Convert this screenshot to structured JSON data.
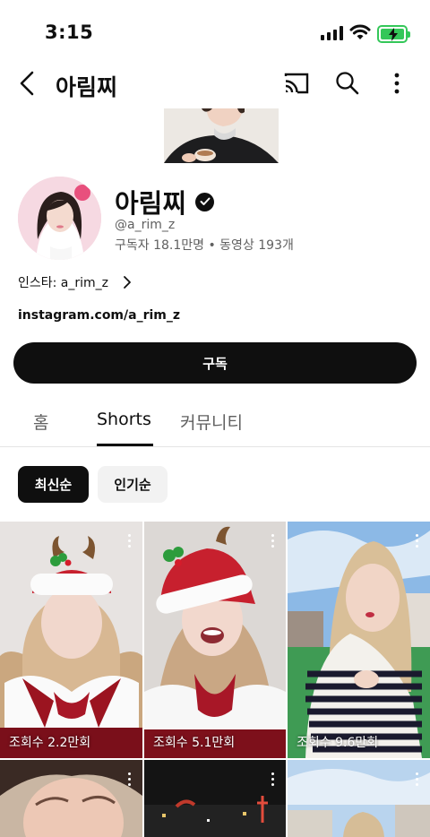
{
  "status_bar": {
    "time": "3:15"
  },
  "app_bar": {
    "title": "아림찌"
  },
  "channel": {
    "name": "아림찌",
    "handle": "@a_rim_z",
    "stats": "구독자 18.1만명 • 동영상 193개",
    "description": "인스타: a_rim_z",
    "link": "instagram.com/a_rim_z",
    "subscribe_label": "구독"
  },
  "tabs": [
    {
      "label": "홈"
    },
    {
      "label": "Shorts"
    },
    {
      "label": "커뮤니티"
    }
  ],
  "chips": [
    {
      "label": "최신순"
    },
    {
      "label": "인기순"
    }
  ],
  "shorts": [
    {
      "views": "조회수 2.2만회"
    },
    {
      "views": "조회수 5.1만회"
    },
    {
      "views": "조회수 9.6만회"
    }
  ],
  "colors": {
    "battery": "#34c759",
    "text": "#0f0f0f",
    "secondary": "#606060"
  }
}
